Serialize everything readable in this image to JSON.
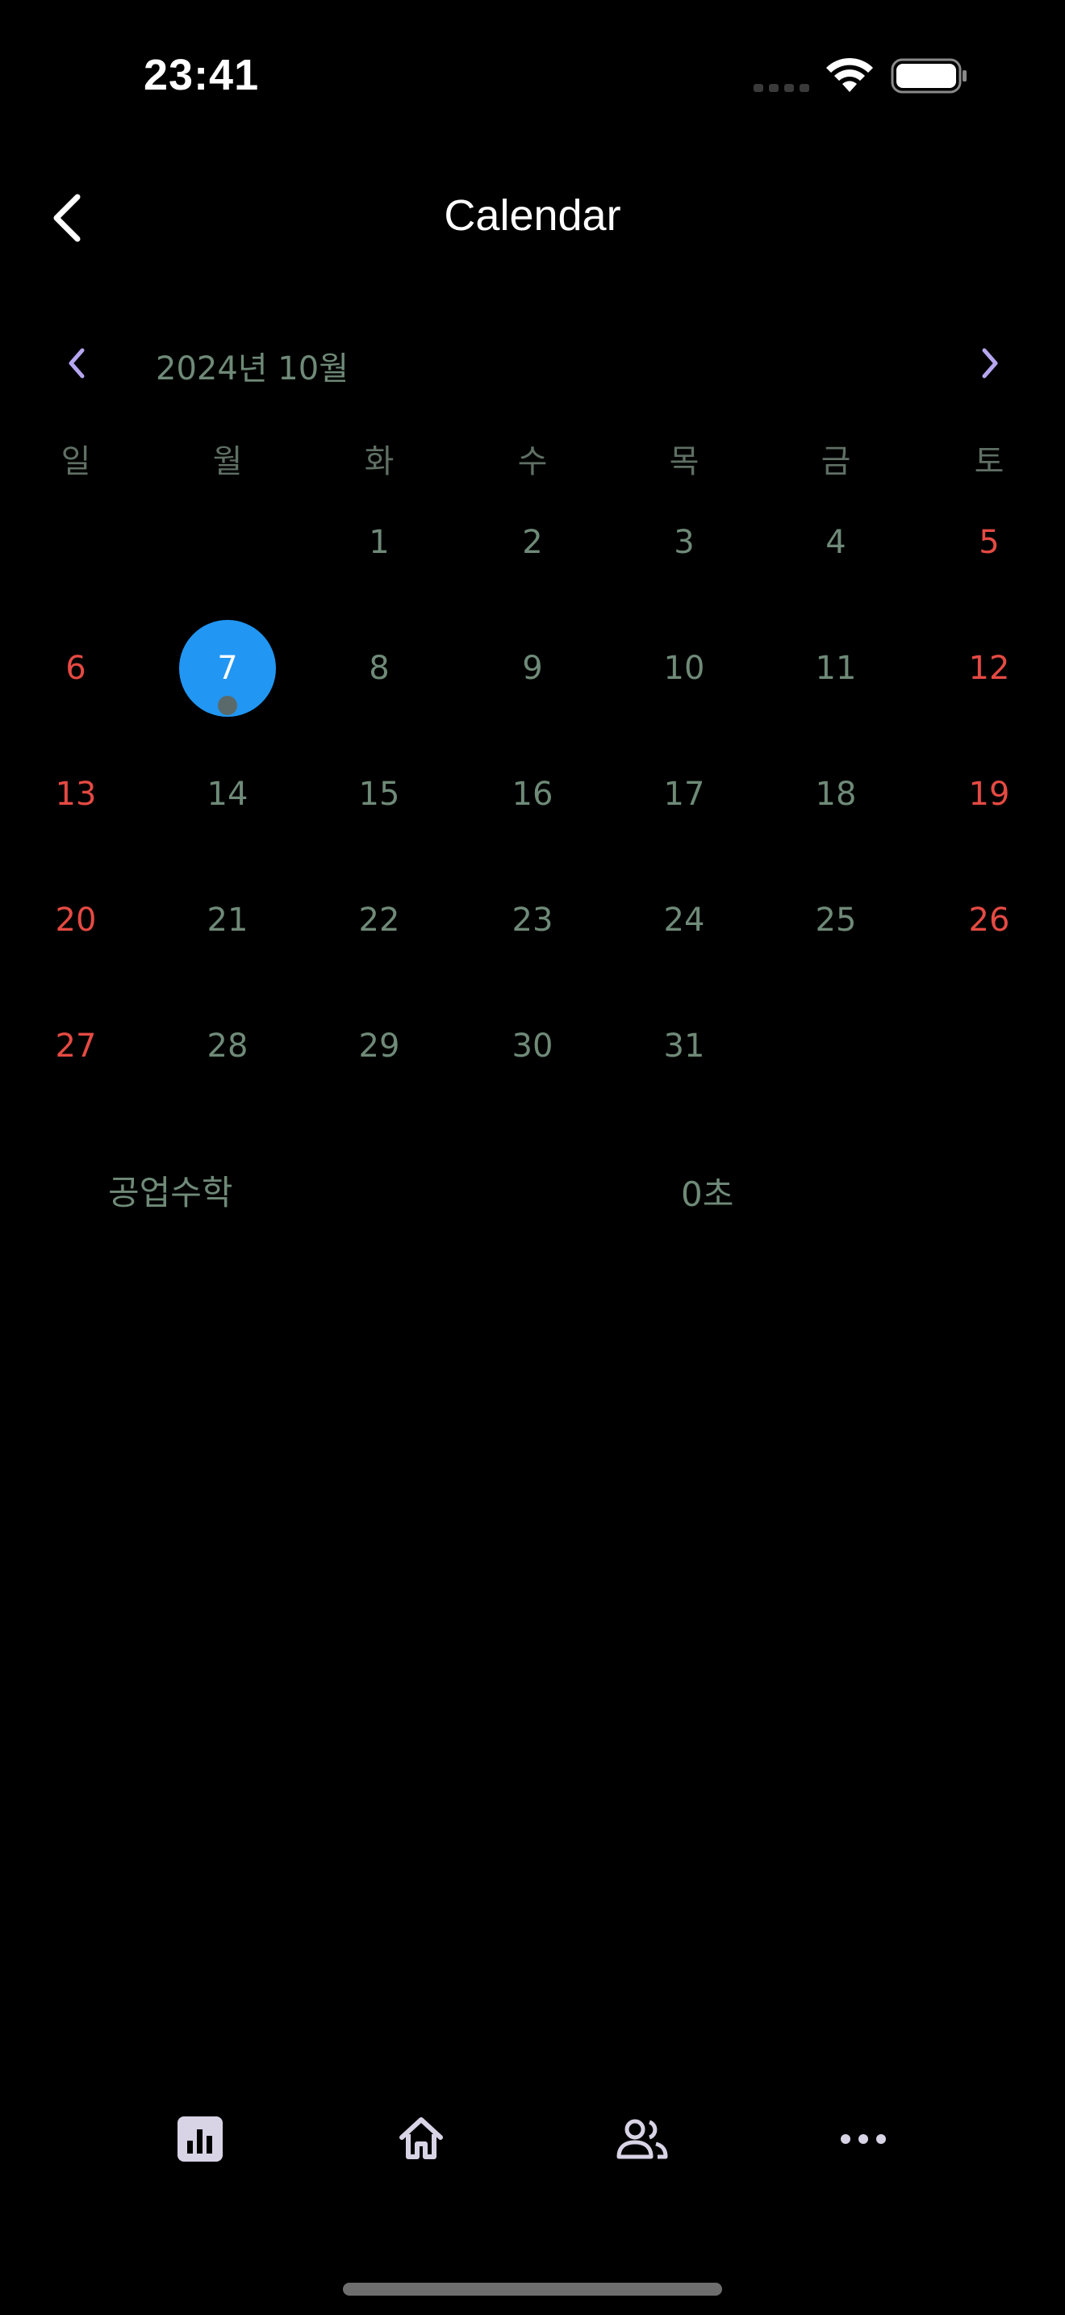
{
  "status_bar": {
    "time": "23:41"
  },
  "header": {
    "title": "Calendar"
  },
  "calendar": {
    "month_label": "2024년 10월",
    "weekdays": [
      "일",
      "월",
      "화",
      "수",
      "목",
      "금",
      "토"
    ],
    "weeks": [
      [
        "",
        "",
        "1",
        "2",
        "3",
        "4",
        "5"
      ],
      [
        "6",
        "7",
        "8",
        "9",
        "10",
        "11",
        "12"
      ],
      [
        "13",
        "14",
        "15",
        "16",
        "17",
        "18",
        "19"
      ],
      [
        "20",
        "21",
        "22",
        "23",
        "24",
        "25",
        "26"
      ],
      [
        "27",
        "28",
        "29",
        "30",
        "31",
        "",
        ""
      ]
    ],
    "selected_day": "7",
    "event_days": [
      "7"
    ],
    "colors": {
      "weekday_text": "#6f8a78",
      "weekend_text": "#e54a43",
      "selected_bg": "#2196f3",
      "nav_arrow": "#b6a6f0"
    }
  },
  "summary": {
    "subject": "공업수학",
    "duration": "0초"
  },
  "bottom_nav": {
    "items": [
      "bar-chart-icon",
      "home-icon",
      "people-icon",
      "more-icon"
    ]
  }
}
